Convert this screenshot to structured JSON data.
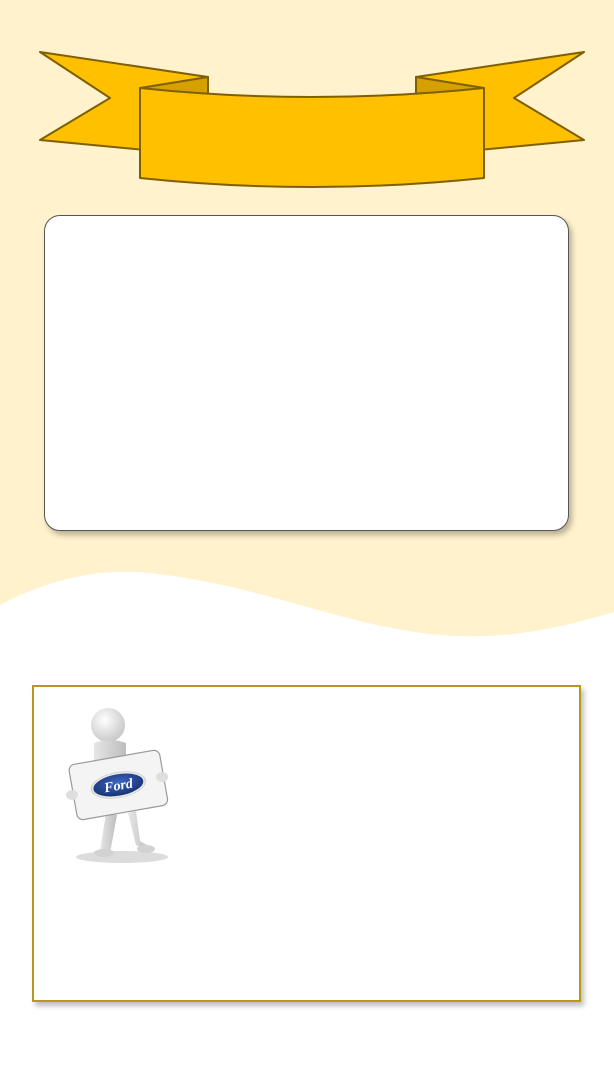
{
  "header": {
    "banner_text": ""
  },
  "info_card": {
    "text": ""
  },
  "brand_card": {
    "logo_text": "Ford",
    "body_text": ""
  },
  "colors": {
    "background_cream": "#fff2cc",
    "ribbon_fill": "#ffc000",
    "ribbon_fold": "#d6a000",
    "ribbon_outline": "#7f6000",
    "card_border": "#b8981b",
    "logo_blue": "#1a3c8c"
  }
}
